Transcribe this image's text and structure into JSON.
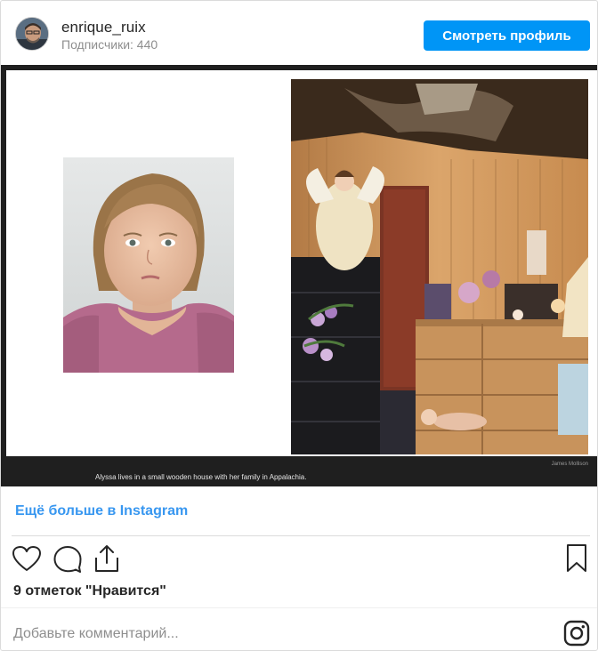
{
  "header": {
    "username": "enrique_ruix",
    "followers": "Подписчики: 440",
    "view_profile_label": "Смотреть профиль"
  },
  "media": {
    "caption": "Alyssa lives in a small wooden house with her family in Appalachia.",
    "credit": "James Mollison"
  },
  "more_link": "Ещё больше в Instagram",
  "actions": {
    "icons": [
      "heart-icon",
      "comment-icon",
      "share-icon",
      "bookmark-icon"
    ]
  },
  "likes": "9 отметок \"Нравится\"",
  "comment": {
    "placeholder": "Добавьте комментарий..."
  },
  "colors": {
    "accent": "#0095f6",
    "link": "#3897f0",
    "muted": "#8e8e8e",
    "text": "#262626"
  }
}
